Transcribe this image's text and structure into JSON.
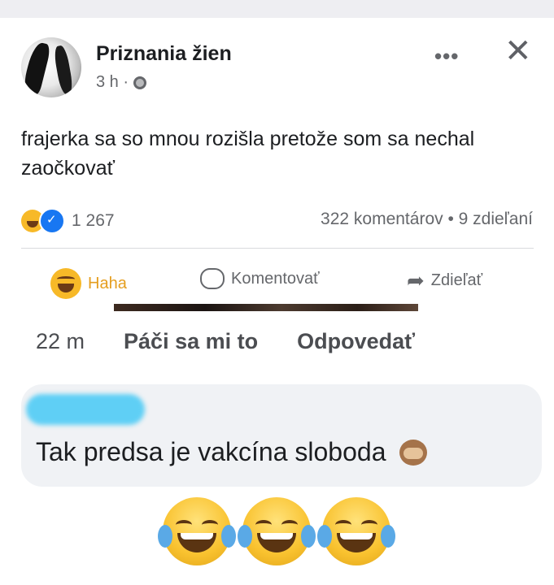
{
  "post": {
    "page_name": "Priznania žien",
    "meta_time": "3 h ·",
    "more_label": "•••",
    "close_label": "✕",
    "text": "frajerka sa so mnou rozišla pretože som sa nechal zaočkovať",
    "reaction_count": "1 267",
    "stats": "322 komentárov • 9 zdieľaní",
    "actions": {
      "haha": "Haha",
      "comment": "Komentovať",
      "share": "Zdieľať"
    }
  },
  "comment_meta": {
    "time": "22 m",
    "like": "Páči sa mi to",
    "reply": "Odpovedať"
  },
  "comment": {
    "text": "Tak predsa je vakcína sloboda"
  },
  "icons": {
    "globe": "globe-icon",
    "haha": "haha-icon",
    "like": "like-icon",
    "comment": "comment-icon",
    "share": "share-icon",
    "monkey": "see-no-evil-monkey-icon",
    "laugh": "face-with-tears-of-joy-icon"
  },
  "colors": {
    "haha_accent": "#e59e1f",
    "like_blue": "#1877f2",
    "name_blur": "#5fcff5"
  }
}
